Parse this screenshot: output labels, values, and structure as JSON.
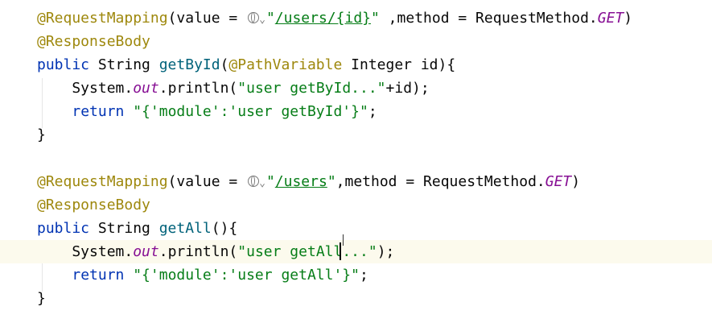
{
  "block1": {
    "mapping_annotation": "@RequestMapping",
    "value_prefix": "(value = ",
    "url_open_quote": "\"",
    "url": "/users/{id}",
    "url_close_quote": "\"",
    "method_part": " ,method = RequestMethod.",
    "http_method": "GET",
    "close_paren": ")",
    "response_body": "@ResponseBody",
    "public_kw": "public ",
    "return_type": "String ",
    "method_name": "getById",
    "open_paren": "(",
    "param_annotation": "@PathVariable",
    "param_rest": " Integer id){",
    "print_prefix": "    System.",
    "out_field": "out",
    "print_call": ".println(",
    "print_string": "\"user getById...\"",
    "print_suffix": "+id);",
    "return_indent": "    ",
    "return_kw": "return ",
    "return_string": "\"{'module':'user getById'}\"",
    "return_semicolon": ";",
    "closing_brace": "}"
  },
  "block2": {
    "mapping_annotation": "@RequestMapping",
    "value_prefix": "(value = ",
    "url_open_quote": "\"",
    "url": "/users",
    "url_close_quote": "\"",
    "method_part": ",method = RequestMethod.",
    "http_method": "GET",
    "close_paren": ")",
    "response_body": "@ResponseBody",
    "public_kw": "public ",
    "return_type": "String ",
    "method_name": "getAll",
    "signature_rest": "(){",
    "print_prefix": "    System.",
    "out_field": "out",
    "print_call": ".println(",
    "print_string_a": "\"user getAl",
    "print_string_b": "l...\"",
    "print_suffix": ");",
    "return_indent": "    ",
    "return_kw": "return ",
    "return_string": "\"{'module':'user getAll'}\"",
    "return_semicolon": ";",
    "closing_brace": "}"
  },
  "icons": {
    "globe": "globe-icon",
    "chevron": "chevron-down-icon",
    "chevron_glyph": "⌄"
  },
  "colors": {
    "annotation": "#9e880d",
    "keyword": "#0033b3",
    "string": "#067d17",
    "method_declaration": "#00627a",
    "static_field": "#871094",
    "current_line": "#fcfaed"
  }
}
